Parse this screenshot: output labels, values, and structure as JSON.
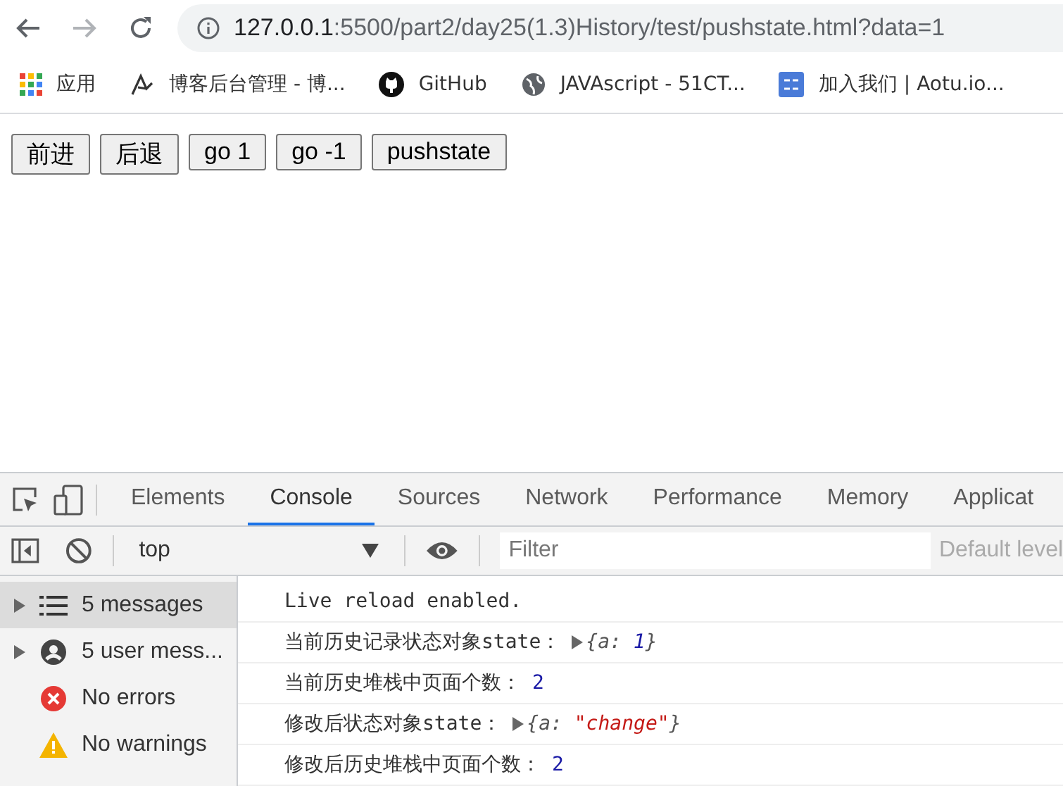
{
  "browser": {
    "url_host": "127.0.0.1",
    "url_rest": ":5500/part2/day25(1.3)History/test/pushstate.html?data=1",
    "bookmarks": [
      {
        "kind": "apps",
        "label": "应用"
      },
      {
        "kind": "blog",
        "label": "博客后台管理 - 博..."
      },
      {
        "kind": "github",
        "label": "GitHub"
      },
      {
        "kind": "globe",
        "label": "JAVAscript - 51CT..."
      },
      {
        "kind": "tile",
        "label": "加入我们 | Aotu.io..."
      }
    ]
  },
  "page": {
    "buttons": [
      "前进",
      "后退",
      "go 1",
      "go -1",
      "pushstate"
    ]
  },
  "devtools": {
    "tabs": [
      {
        "label": "Elements",
        "selected": false
      },
      {
        "label": "Console",
        "selected": true
      },
      {
        "label": "Sources",
        "selected": false
      },
      {
        "label": "Network",
        "selected": false
      },
      {
        "label": "Performance",
        "selected": false
      },
      {
        "label": "Memory",
        "selected": false
      },
      {
        "label": "Applicat",
        "selected": false
      }
    ],
    "context": "top",
    "filter": {
      "placeholder": "Filter"
    },
    "levels": "Default level",
    "sidebar": [
      {
        "kind": "messages",
        "label": "5 messages",
        "expandable": true,
        "selected": true
      },
      {
        "kind": "user",
        "label": "5 user mess...",
        "expandable": true,
        "selected": false
      },
      {
        "kind": "errors",
        "label": "No errors",
        "expandable": false,
        "selected": false
      },
      {
        "kind": "warnings",
        "label": "No warnings",
        "expandable": false,
        "selected": false
      }
    ],
    "lines": [
      {
        "kind": "text",
        "text": "Live reload enabled."
      },
      {
        "kind": "object",
        "text": "当前历史记录状态对象state：",
        "prefix": "{a: ",
        "value": "1",
        "is_string": false,
        "suffix": "}"
      },
      {
        "kind": "value",
        "text": "当前历史堆栈中页面个数：",
        "value": "2",
        "is_string": false
      },
      {
        "kind": "object",
        "text": "修改后状态对象state：",
        "prefix": "{a: ",
        "value": "\"change\"",
        "is_string": true,
        "suffix": "}"
      },
      {
        "kind": "value",
        "text": "修改后历史堆栈中页面个数：",
        "value": "2",
        "is_string": false
      }
    ]
  }
}
